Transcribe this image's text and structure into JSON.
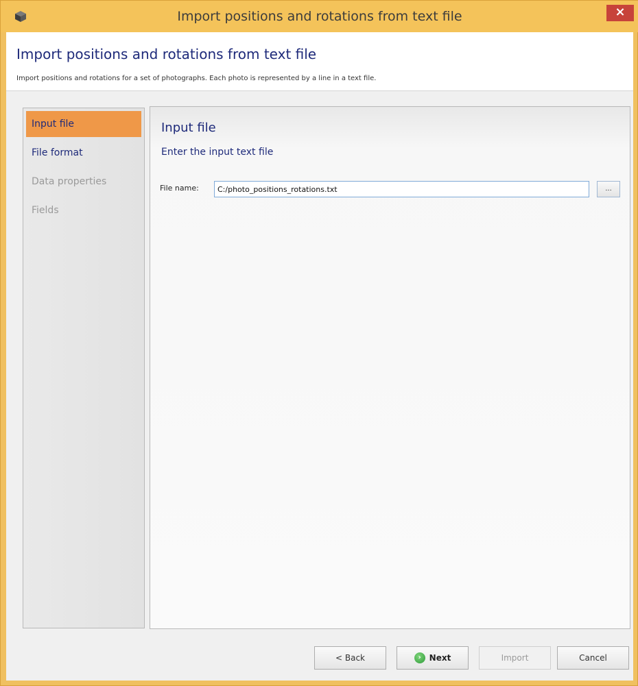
{
  "window": {
    "title": "Import positions and rotations from text file",
    "close_glyph": "×"
  },
  "header": {
    "title": "Import positions and rotations from text file",
    "description": "Import positions and rotations for a set of photographs. Each photo is represented by a line in a text file."
  },
  "sidebar": {
    "items": [
      {
        "label": "Input file",
        "state": "active"
      },
      {
        "label": "File format",
        "state": "enabled"
      },
      {
        "label": "Data properties",
        "state": "disabled"
      },
      {
        "label": "Fields",
        "state": "disabled"
      }
    ]
  },
  "content": {
    "title": "Input file",
    "subtitle": "Enter the input text file",
    "file_label": "File name:",
    "file_value": "C:/photo_positions_rotations.txt",
    "browse_label": "..."
  },
  "footer": {
    "back_label": "< Back",
    "next_label": "Next",
    "import_label": "Import",
    "cancel_label": "Cancel"
  },
  "colors": {
    "frame": "#f4c35a",
    "active_item": "#ef9848",
    "heading": "#1e2a7a",
    "close_button": "#c7433a"
  },
  "icons": {
    "app": "cube-icon",
    "close": "close-icon",
    "next": "arrow-right-circle-icon"
  }
}
